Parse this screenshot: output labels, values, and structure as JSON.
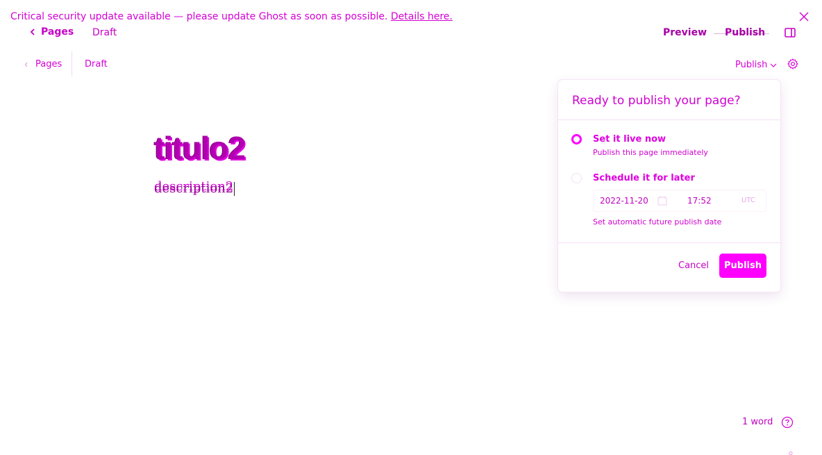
{
  "banner": {
    "message": "Critical security update available — please update Ghost as soon as possible.",
    "link": "Details here."
  },
  "top_nav": {
    "back_label": "Pages",
    "status": "Draft",
    "preview_label": "Preview",
    "publish_label": "Publish"
  },
  "sub_nav": {
    "back_label": "Pages",
    "status": "Draft",
    "publish_label": "Publish"
  },
  "editor": {
    "title": "titulo2",
    "description": "description2"
  },
  "publish_menu": {
    "title": "Ready to publish your page?",
    "option_live": {
      "label": "Set it live now",
      "description": "Publish this page immediately",
      "selected": true
    },
    "option_schedule": {
      "label": "Schedule it for later",
      "date": "2022-11-20",
      "time": "17:52",
      "timezone": "UTC",
      "description": "Set automatic future publish date",
      "selected": false
    },
    "cancel_label": "Cancel",
    "publish_label": "Publish"
  },
  "footer": {
    "word_count": "1 word"
  },
  "icons": {
    "close": "close-icon",
    "back": "chevron-left-icon",
    "sidebar": "sidebar-toggle-icon",
    "dropdown": "chevron-down-icon",
    "settings": "gear-icon",
    "calendar": "calendar-icon",
    "help": "help-icon"
  },
  "colors": {
    "accent": "#ff00ff",
    "text": "#d600d6",
    "background": "#ffffff"
  }
}
